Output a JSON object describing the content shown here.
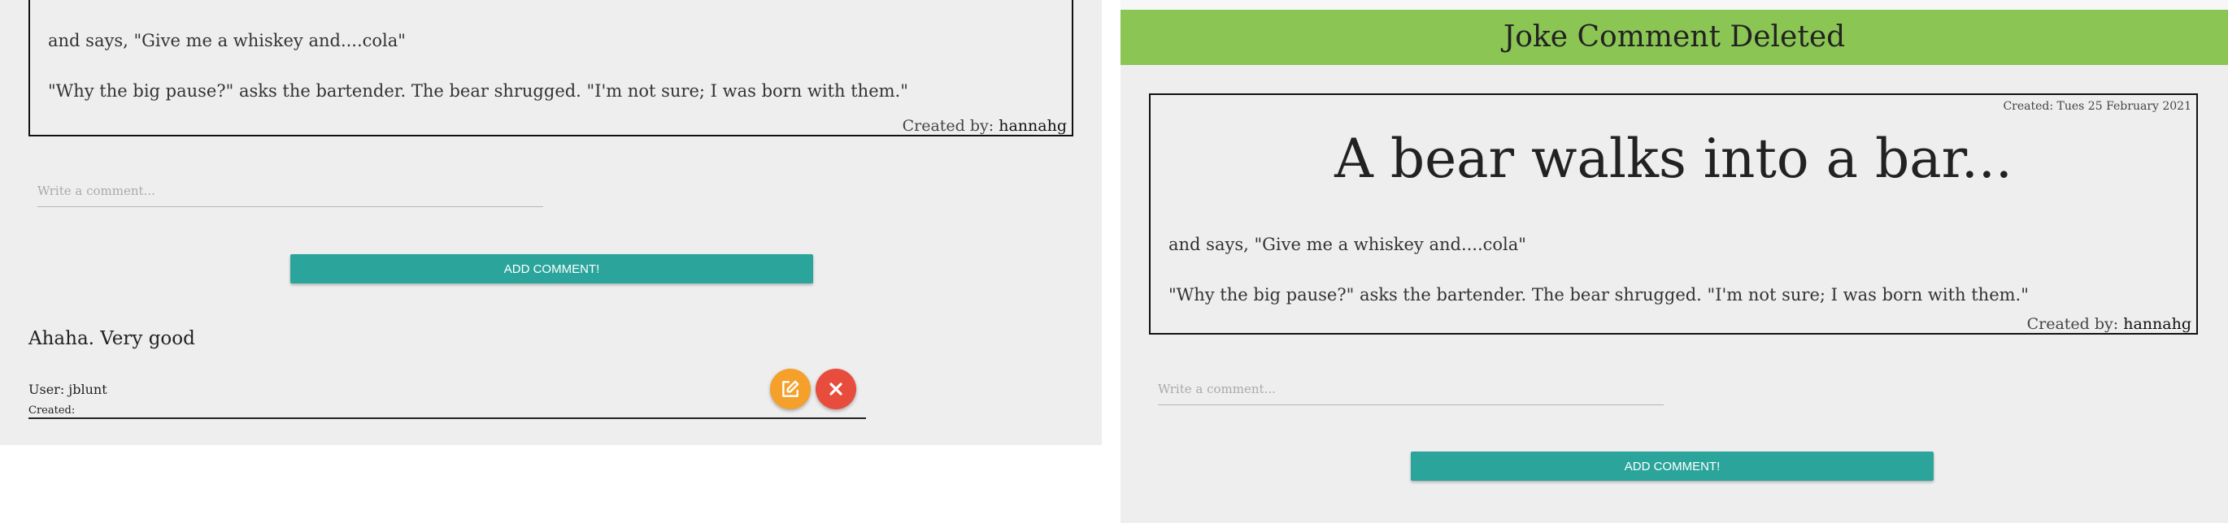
{
  "left": {
    "joke": {
      "line1": "and says, \"Give me a whiskey and....cola\"",
      "line2": "\"Why the big pause?\" asks the bartender. The bear shrugged. \"I'm not sure; I was born with them.\"",
      "created_by_label": "Created by:",
      "created_by_user": "hannahg"
    },
    "comment_input": {
      "placeholder": "Write a comment...",
      "value": ""
    },
    "add_button_label": "ADD COMMENT!",
    "comment": {
      "text": "Ahaha. Very good",
      "user": "User: jblunt",
      "created": "Created:"
    }
  },
  "right": {
    "banner": "Joke Comment Deleted",
    "joke": {
      "created_date": "Created: Tues 25 February 2021",
      "title": "A bear walks into a bar...",
      "line1": "and says, \"Give me a whiskey and....cola\"",
      "line2": "\"Why the big pause?\" asks the bartender. The bear shrugged. \"I'm not sure; I was born with them.\"",
      "created_by_label": "Created by:",
      "created_by_user": "hannahg"
    },
    "comment_input": {
      "placeholder": "Write a comment...",
      "value": ""
    },
    "add_button_label": "ADD COMMENT!"
  },
  "colors": {
    "panel_bg": "#eeeeee",
    "banner_green": "#8bc553",
    "button_teal": "#2ba59b",
    "edit_orange": "#f4a02a",
    "delete_red": "#e74c3c"
  },
  "icons": {
    "edit": "edit-pencil-square-icon",
    "delete": "close-x-icon"
  }
}
